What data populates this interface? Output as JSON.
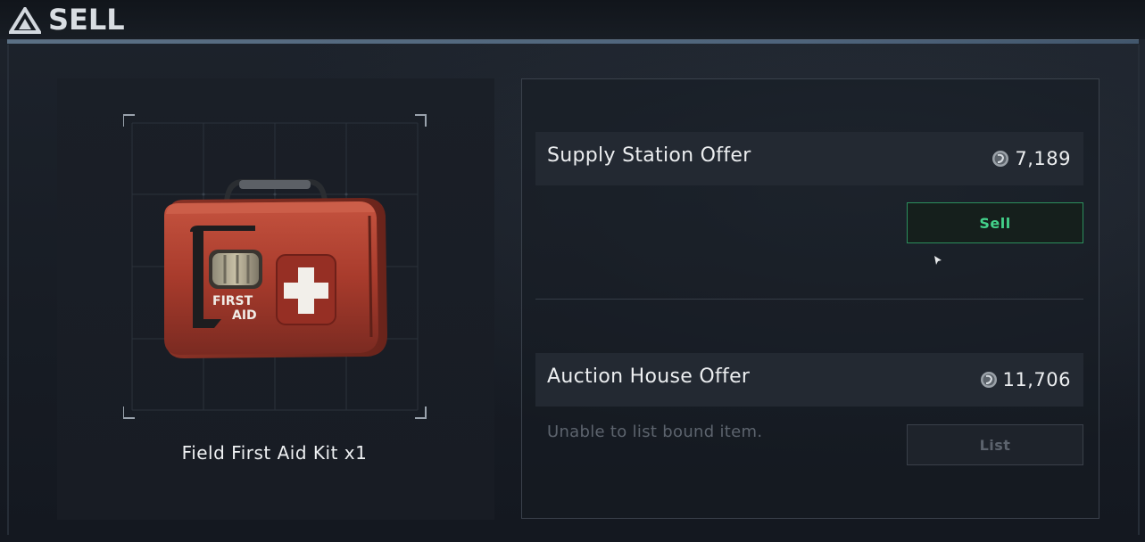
{
  "header": {
    "title": "SELL",
    "logo_icon": "triangle-logo-icon"
  },
  "item": {
    "name": "Field First Aid Kit x1",
    "image_icon": "first-aid-kit-icon",
    "image_text_line1": "FIRST",
    "image_text_line2": "AID"
  },
  "supply_offer": {
    "label": "Supply Station Offer",
    "price": "7,189",
    "currency_icon": "coin-icon",
    "button_label": "Sell"
  },
  "auction_offer": {
    "label": "Auction House Offer",
    "price": "11,706",
    "currency_icon": "coin-icon",
    "status_text": "Unable to list bound item.",
    "button_label": "List"
  },
  "colors": {
    "accent_green": "#43d18a",
    "header_line": "#6f8aa3",
    "kit_red": "#b3412f"
  }
}
